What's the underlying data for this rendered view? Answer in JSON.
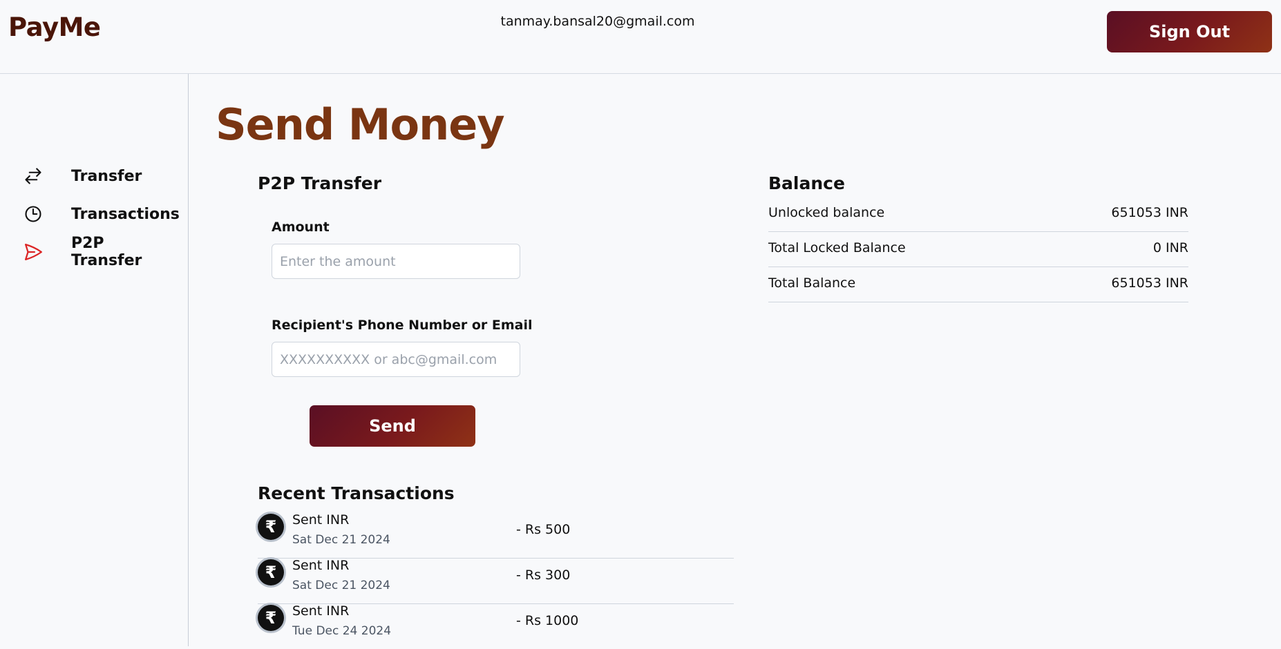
{
  "header": {
    "brand": "PayMe",
    "user_email": "tanmay.bansal20@gmail.com",
    "signout_label": "Sign Out"
  },
  "sidebar": {
    "items": [
      {
        "label": "Transfer",
        "icon": "arrows-left-right-icon",
        "active": false
      },
      {
        "label": "Transactions",
        "icon": "clock-icon",
        "active": false
      },
      {
        "label": "P2P Transfer",
        "icon": "send-icon",
        "active": true
      }
    ],
    "active_color": "#dc2626"
  },
  "main": {
    "page_title": "Send Money",
    "p2p": {
      "title": "P2P Transfer",
      "amount_label": "Amount",
      "amount_placeholder": "Enter the amount",
      "amount_value": "",
      "recipient_label": "Recipient's Phone Number or Email",
      "recipient_placeholder": "XXXXXXXXXX or abc@gmail.com",
      "recipient_value": "",
      "send_label": "Send"
    },
    "recent": {
      "title": "Recent Transactions",
      "items": [
        {
          "title": "Sent INR",
          "date": "Sat Dec 21 2024",
          "amount": "- Rs 500"
        },
        {
          "title": "Sent INR",
          "date": "Sat Dec 21 2024",
          "amount": "- Rs 300"
        },
        {
          "title": "Sent INR",
          "date": "Tue Dec 24 2024",
          "amount": "- Rs 1000"
        }
      ]
    },
    "balance": {
      "title": "Balance",
      "rows": [
        {
          "label": "Unlocked balance",
          "value": "651053 INR"
        },
        {
          "label": "Total Locked Balance",
          "value": "0 INR"
        },
        {
          "label": "Total Balance",
          "value": "651053 INR"
        }
      ]
    }
  },
  "colors": {
    "brand": "#4a1508",
    "title": "#7a3512",
    "button_gradient_start": "#5a0f24",
    "button_gradient_end": "#8f3216",
    "background": "#f8f9fb"
  }
}
